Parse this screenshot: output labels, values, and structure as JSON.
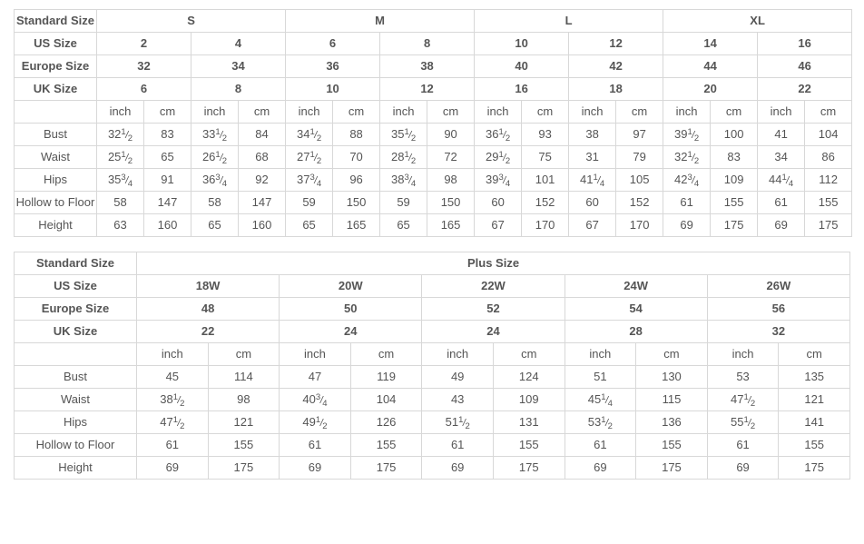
{
  "standard_table": {
    "row_header_labels": {
      "standard_size": "Standard Size",
      "us_size": "US Size",
      "europe_size": "Europe Size",
      "uk_size": "UK Size"
    },
    "size_groups": [
      "S",
      "M",
      "L",
      "XL"
    ],
    "us_sizes": [
      "2",
      "4",
      "6",
      "8",
      "10",
      "12",
      "14",
      "16"
    ],
    "europe_sizes": [
      "32",
      "34",
      "36",
      "38",
      "40",
      "42",
      "44",
      "46"
    ],
    "uk_sizes": [
      "6",
      "8",
      "10",
      "12",
      "16",
      "18",
      "20",
      "22"
    ],
    "units": [
      "inch",
      "cm",
      "inch",
      "cm",
      "inch",
      "cm",
      "inch",
      "cm",
      "inch",
      "cm",
      "inch",
      "cm",
      "inch",
      "cm",
      "inch",
      "cm"
    ],
    "measurement_rows": [
      {
        "label": "Bust",
        "values": [
          {
            "whole": "32",
            "num": "1",
            "den": "2"
          },
          "83",
          {
            "whole": "33",
            "num": "1",
            "den": "2"
          },
          "84",
          {
            "whole": "34",
            "num": "1",
            "den": "2"
          },
          "88",
          {
            "whole": "35",
            "num": "1",
            "den": "2"
          },
          "90",
          {
            "whole": "36",
            "num": "1",
            "den": "2"
          },
          "93",
          "38",
          "97",
          {
            "whole": "39",
            "num": "1",
            "den": "2"
          },
          "100",
          "41",
          "104"
        ]
      },
      {
        "label": "Waist",
        "values": [
          {
            "whole": "25",
            "num": "1",
            "den": "2"
          },
          "65",
          {
            "whole": "26",
            "num": "1",
            "den": "2"
          },
          "68",
          {
            "whole": "27",
            "num": "1",
            "den": "2"
          },
          "70",
          {
            "whole": "28",
            "num": "1",
            "den": "2"
          },
          "72",
          {
            "whole": "29",
            "num": "1",
            "den": "2"
          },
          "75",
          "31",
          "79",
          {
            "whole": "32",
            "num": "1",
            "den": "2"
          },
          "83",
          "34",
          "86"
        ]
      },
      {
        "label": "Hips",
        "values": [
          {
            "whole": "35",
            "num": "3",
            "den": "4"
          },
          "91",
          {
            "whole": "36",
            "num": "3",
            "den": "4"
          },
          "92",
          {
            "whole": "37",
            "num": "3",
            "den": "4"
          },
          "96",
          {
            "whole": "38",
            "num": "3",
            "den": "4"
          },
          "98",
          {
            "whole": "39",
            "num": "3",
            "den": "4"
          },
          "101",
          {
            "whole": "41",
            "num": "1",
            "den": "4"
          },
          "105",
          {
            "whole": "42",
            "num": "3",
            "den": "4"
          },
          "109",
          {
            "whole": "44",
            "num": "1",
            "den": "4"
          },
          "112"
        ]
      },
      {
        "label": "Hollow to Floor",
        "values": [
          "58",
          "147",
          "58",
          "147",
          "59",
          "150",
          "59",
          "150",
          "60",
          "152",
          "60",
          "152",
          "61",
          "155",
          "61",
          "155"
        ]
      },
      {
        "label": "Height",
        "values": [
          "63",
          "160",
          "65",
          "160",
          "65",
          "165",
          "65",
          "165",
          "67",
          "170",
          "67",
          "170",
          "69",
          "175",
          "69",
          "175"
        ]
      }
    ]
  },
  "plus_table": {
    "row_header_labels": {
      "standard_size": "Standard Size",
      "us_size": "US Size",
      "europe_size": "Europe Size",
      "uk_size": "UK Size"
    },
    "group_title": "Plus Size",
    "us_sizes": [
      "18W",
      "20W",
      "22W",
      "24W",
      "26W"
    ],
    "europe_sizes": [
      "48",
      "50",
      "52",
      "54",
      "56"
    ],
    "uk_sizes": [
      "22",
      "24",
      "24",
      "28",
      "32"
    ],
    "units": [
      "inch",
      "cm",
      "inch",
      "cm",
      "inch",
      "cm",
      "inch",
      "cm",
      "inch",
      "cm"
    ],
    "measurement_rows": [
      {
        "label": "Bust",
        "values": [
          "45",
          "114",
          "47",
          "119",
          "49",
          "124",
          "51",
          "130",
          "53",
          "135"
        ]
      },
      {
        "label": "Waist",
        "values": [
          {
            "whole": "38",
            "num": "1",
            "den": "2"
          },
          "98",
          {
            "whole": "40",
            "num": "3",
            "den": "4"
          },
          "104",
          "43",
          "109",
          {
            "whole": "45",
            "num": "1",
            "den": "4"
          },
          "115",
          {
            "whole": "47",
            "num": "1",
            "den": "2"
          },
          "121"
        ]
      },
      {
        "label": "Hips",
        "values": [
          {
            "whole": "47",
            "num": "1",
            "den": "2"
          },
          "121",
          {
            "whole": "49",
            "num": "1",
            "den": "2"
          },
          "126",
          {
            "whole": "51",
            "num": "1",
            "den": "2"
          },
          "131",
          {
            "whole": "53",
            "num": "1",
            "den": "2"
          },
          "136",
          {
            "whole": "55",
            "num": "1",
            "den": "2"
          },
          "141"
        ]
      },
      {
        "label": "Hollow to Floor",
        "values": [
          "61",
          "155",
          "61",
          "155",
          "61",
          "155",
          "61",
          "155",
          "61",
          "155"
        ]
      },
      {
        "label": "Height",
        "values": [
          "69",
          "175",
          "69",
          "175",
          "69",
          "175",
          "69",
          "175",
          "69",
          "175"
        ]
      }
    ]
  },
  "colors": {
    "header_bg": "#ebebeb",
    "border": "#d8d8d8",
    "header_text": "#1c1c1c",
    "value_text": "#6b6b6b",
    "unit_text": "#8d8d8d",
    "page_bg": "#ffffff"
  }
}
